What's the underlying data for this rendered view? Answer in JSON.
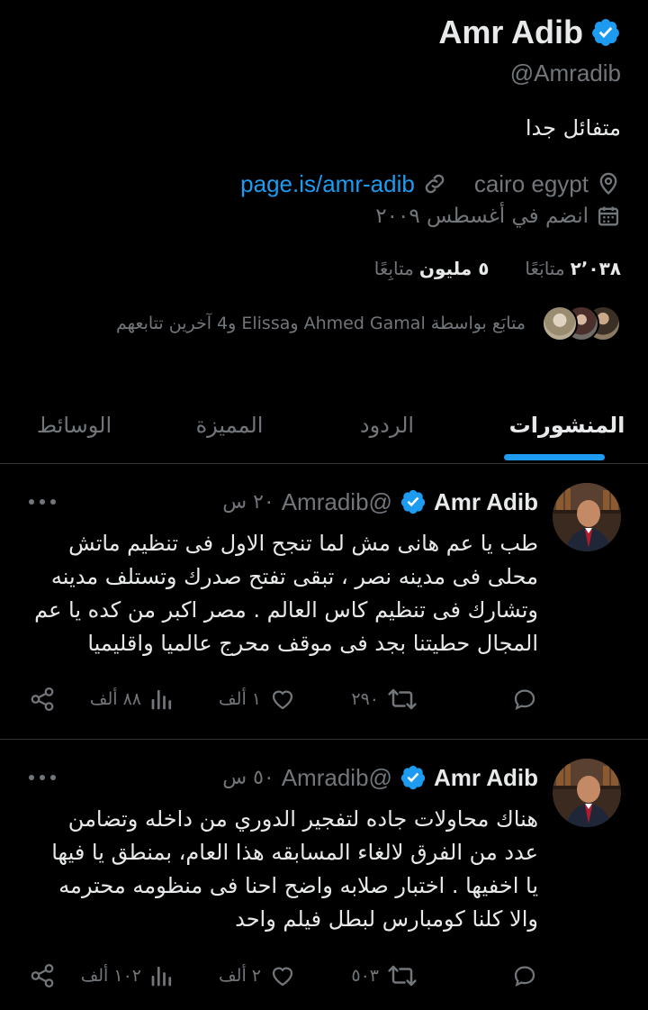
{
  "profile": {
    "name": "Amr Adib",
    "handle": "@Amradib",
    "bio": "متفائل جدا",
    "location": "cairo egypt",
    "link": "page.is/amr-adib",
    "joined": "انضم في أغسطس ٢٠٠٩",
    "following_count": "٢٬٠٣٨",
    "following_label": "متابَعًا",
    "followers_count": "٥ مليون",
    "followers_label": "متابِعًا",
    "followed_by": "متابَع بواسطة Ahmed Gamal وElissa و4 آخرين تتابعهم"
  },
  "tabs": [
    {
      "label": "المنشورات",
      "active": true
    },
    {
      "label": "الردود",
      "active": false
    },
    {
      "label": "المميزة",
      "active": false
    },
    {
      "label": "الوسائط",
      "active": false
    }
  ],
  "tweets": [
    {
      "name": "Amr Adib",
      "handle": "@Amradib",
      "time": "٢٠ س",
      "text": "طب يا عم هانى مش لما تنجح الاول فى تنظيم ماتش محلى فى مدينه نصر ، تبقى تفتح صدرك وتستلف مدينه وتشارك فى تنظيم كاس العالم . مصر اكبر من كده يا عم المجال حطيتنا بجد فى موقف محرج عالميا واقليميا",
      "replies": "",
      "retweets": "٢٩٠",
      "likes": "١ ألف",
      "views": "٨٨ ألف"
    },
    {
      "name": "Amr Adib",
      "handle": "@Amradib",
      "time": "٥٠ س",
      "text": "هناك محاولات جاده لتفجير الدوري من داخله وتضامن عدد من الفرق لالغاء المسابقه هذا العام، بمنطق يا فيها يا اخفيها . اختبار صلابه واضح احنا فى منظومه محترمه والا كلنا كومبارس لبطل فيلم واحد",
      "replies": "",
      "retweets": "٥٠٣",
      "likes": "٢ ألف",
      "views": "١٠٢ ألف"
    }
  ],
  "colors": {
    "background": "#000000",
    "accent": "#1d9bf0",
    "text": "#e7e9ea",
    "muted": "#71767b",
    "divider": "#2f3336"
  },
  "icons": [
    "verified-badge-icon",
    "location-pin-icon",
    "link-icon",
    "calendar-icon",
    "more-dots-icon",
    "reply-icon",
    "retweet-icon",
    "like-icon",
    "views-icon",
    "share-icon"
  ]
}
